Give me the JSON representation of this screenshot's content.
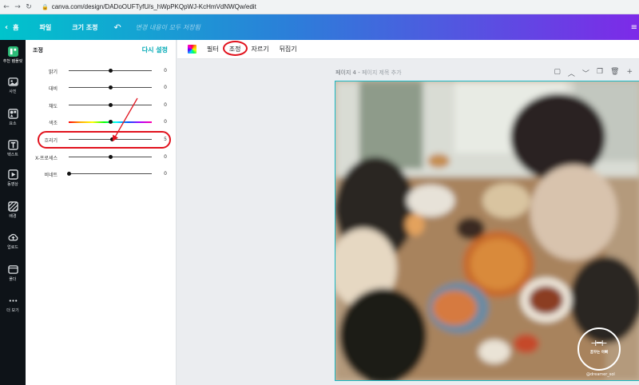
{
  "browser": {
    "url": "canva.com/design/DADoOUFTyfU/s_hWpPKQpWJ-KcHmVdNWQw/edit"
  },
  "topbar": {
    "home_label": "홈",
    "file_label": "파일",
    "resize_label": "크기 조정",
    "status_text": "변경 내용이 모두 저장됨",
    "more_label": "≡"
  },
  "leftnav": {
    "items": [
      {
        "label": "추천 템플릿",
        "icon": "template-icon"
      },
      {
        "label": "사진",
        "icon": "photo-icon"
      },
      {
        "label": "요소",
        "icon": "elements-icon"
      },
      {
        "label": "텍스트",
        "icon": "text-icon"
      },
      {
        "label": "동영상",
        "icon": "video-icon"
      },
      {
        "label": "배경",
        "icon": "background-icon"
      },
      {
        "label": "업로드",
        "icon": "upload-icon"
      },
      {
        "label": "폴더",
        "icon": "folder-icon"
      },
      {
        "label": "더 보기",
        "icon": "more-icon"
      }
    ]
  },
  "panel": {
    "title": "조정",
    "reset_label": "다시 설정",
    "sliders": [
      {
        "label": "밝기",
        "value": "0",
        "level": 0
      },
      {
        "label": "대비",
        "value": "0",
        "level": 0
      },
      {
        "label": "채도",
        "value": "0",
        "level": 0
      },
      {
        "label": "색조",
        "value": "0",
        "level": 0
      },
      {
        "label": "흐리기",
        "value": "5",
        "level": 5
      },
      {
        "label": "X-프로세스",
        "value": "0",
        "level": 0
      },
      {
        "label": "비네트",
        "value": "0",
        "level": 0
      }
    ]
  },
  "toolbar": {
    "filter_label": "필터",
    "adjust_label": "조정",
    "crop_label": "자르기",
    "flip_label": "뒤집기"
  },
  "canvas": {
    "page_label": "페이지 4 -",
    "page_title_placeholder": "페이지 제목 추가",
    "watermark_name": "꿈꾸는 아빠",
    "watermark_handle": "@dreamer_sol"
  },
  "colors": {
    "accent": "#00c4cc",
    "highlight_red": "#e1121d"
  }
}
